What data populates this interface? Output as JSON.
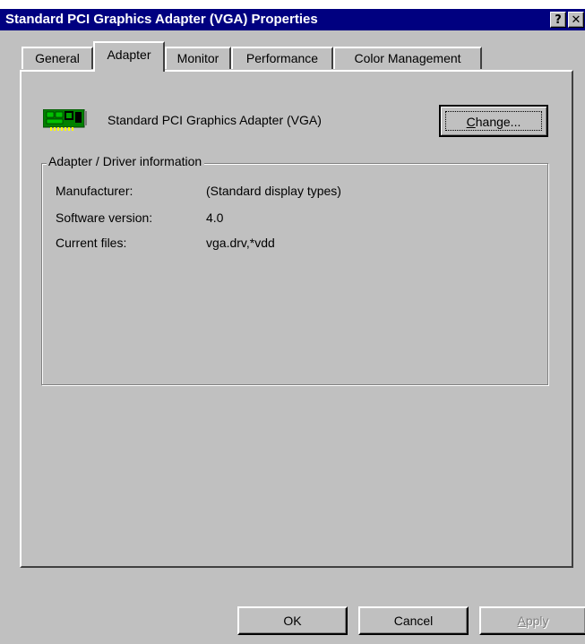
{
  "window": {
    "title": "Standard PCI Graphics Adapter (VGA) Properties",
    "help_glyph": "?",
    "close_glyph": "✕"
  },
  "tabs": [
    {
      "label": "General",
      "active": false
    },
    {
      "label": "Adapter",
      "active": true
    },
    {
      "label": "Monitor",
      "active": false
    },
    {
      "label": "Performance",
      "active": false
    },
    {
      "label": "Color Management",
      "active": false
    }
  ],
  "adapter": {
    "icon": "display-adapter-card-icon",
    "name": "Standard PCI Graphics Adapter (VGA)",
    "change_button": {
      "mnemonic": "C",
      "rest": "hange..."
    }
  },
  "driver_info": {
    "legend": "Adapter / Driver information",
    "rows": [
      {
        "label": "Manufacturer:",
        "value": "(Standard display types)"
      },
      {
        "label": "Software version:",
        "value": "4.0"
      },
      {
        "label": "Current files:",
        "value": "vga.drv,*vdd"
      }
    ]
  },
  "buttons": {
    "ok": "OK",
    "cancel": "Cancel",
    "apply_mnemonic": "A",
    "apply_rest": "pply"
  },
  "colors": {
    "titlebar": "#000080",
    "face": "#c0c0c0",
    "icon_board": "#008000",
    "icon_pins": "#ffff00"
  }
}
